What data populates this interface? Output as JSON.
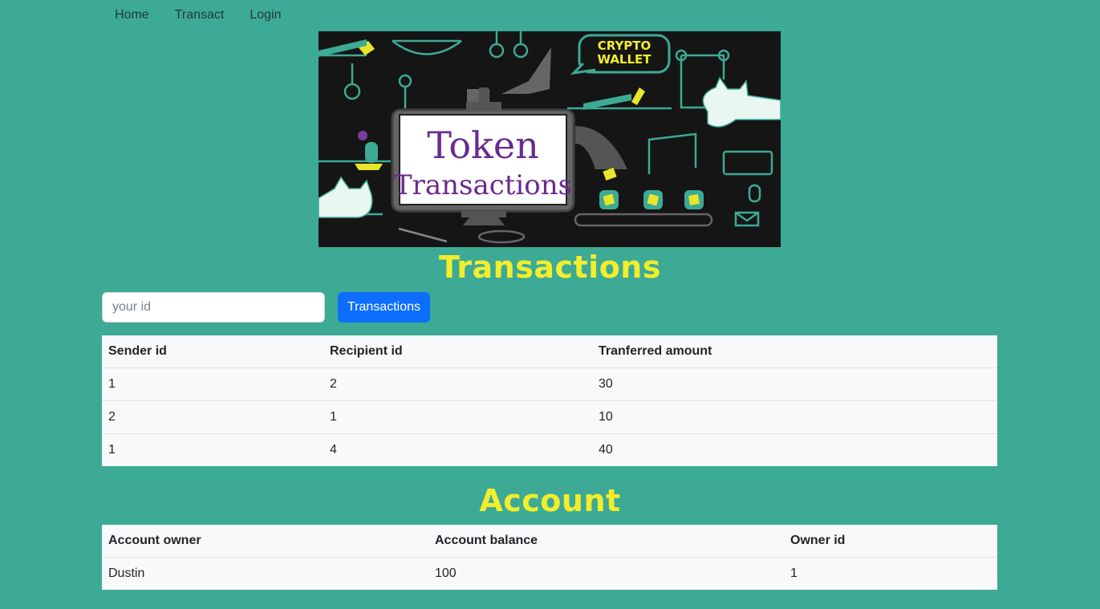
{
  "nav": {
    "items": [
      "Home",
      "Transact",
      "Login"
    ]
  },
  "banner": {
    "title_line1": "Token",
    "title_line2": "Transactions",
    "bubble_line1": "CRYPTO",
    "bubble_line2": "WALLET"
  },
  "transactions": {
    "heading": "Transactions",
    "search_placeholder": "your id",
    "search_value": "",
    "button_label": "Transactions",
    "columns": [
      "Sender id",
      "Recipient id",
      "Tranferred amount"
    ],
    "rows": [
      [
        "1",
        "2",
        "30"
      ],
      [
        "2",
        "1",
        "10"
      ],
      [
        "1",
        "4",
        "40"
      ]
    ]
  },
  "account": {
    "heading": "Account",
    "columns": [
      "Account owner",
      "Account balance",
      "Owner id"
    ],
    "rows": [
      [
        "Dustin",
        "100",
        "1"
      ]
    ]
  },
  "colors": {
    "background": "#3daa95",
    "heading_yellow": "#f2ee2b",
    "button_blue": "#0d6efd",
    "banner_purple": "#6a2a8f"
  }
}
